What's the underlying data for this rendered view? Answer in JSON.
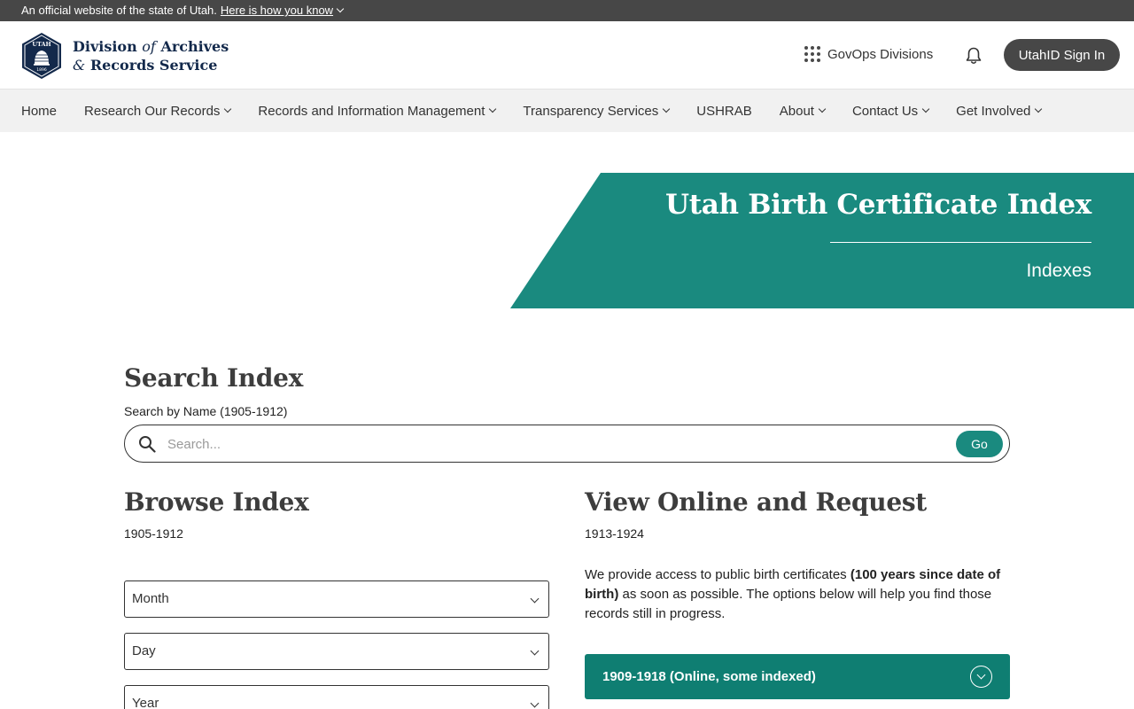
{
  "official_banner": {
    "text": "An official website of the state of Utah.",
    "link": "Here is how you know"
  },
  "header": {
    "logo_line1": "Division",
    "logo_of": "of",
    "logo_line1b": "Archives",
    "logo_amp": "&",
    "logo_line2": "Records Service",
    "seal_text_top": "UTAH",
    "seal_text_bottom": "1896",
    "govops_label": "GovOps Divisions",
    "signin_label": "UtahID Sign In"
  },
  "nav": {
    "items": [
      {
        "label": "Home",
        "dropdown": false
      },
      {
        "label": "Research Our Records",
        "dropdown": true
      },
      {
        "label": "Records and Information Management",
        "dropdown": true
      },
      {
        "label": "Transparency Services",
        "dropdown": true
      },
      {
        "label": "USHRAB",
        "dropdown": false
      },
      {
        "label": "About",
        "dropdown": true
      },
      {
        "label": "Contact Us",
        "dropdown": true
      },
      {
        "label": "Get Involved",
        "dropdown": true
      }
    ]
  },
  "hero": {
    "title": "Utah Birth Certificate Index",
    "subtitle": "Indexes"
  },
  "search": {
    "heading": "Search Index",
    "label": "Search by Name (1905-1912)",
    "placeholder": "Search...",
    "go_label": "Go"
  },
  "browse": {
    "heading": "Browse Index",
    "range": "1905-1912",
    "selects": {
      "month": "Month",
      "day": "Day",
      "year": "Year"
    }
  },
  "view": {
    "heading": "View Online and Request",
    "range": "1913-1924",
    "para_start": "We provide access to public birth certificates ",
    "para_bold": "(100 years since date of birth)",
    "para_end": " as soon as possible. The options below will help you find those records still in progress.",
    "accordion_label": "1909-1918 (Online, some indexed)"
  },
  "colors": {
    "teal": "#1a8a7f",
    "dark_teal": "#0f7e72",
    "navy": "#13294b",
    "banner_gray": "#474747"
  }
}
